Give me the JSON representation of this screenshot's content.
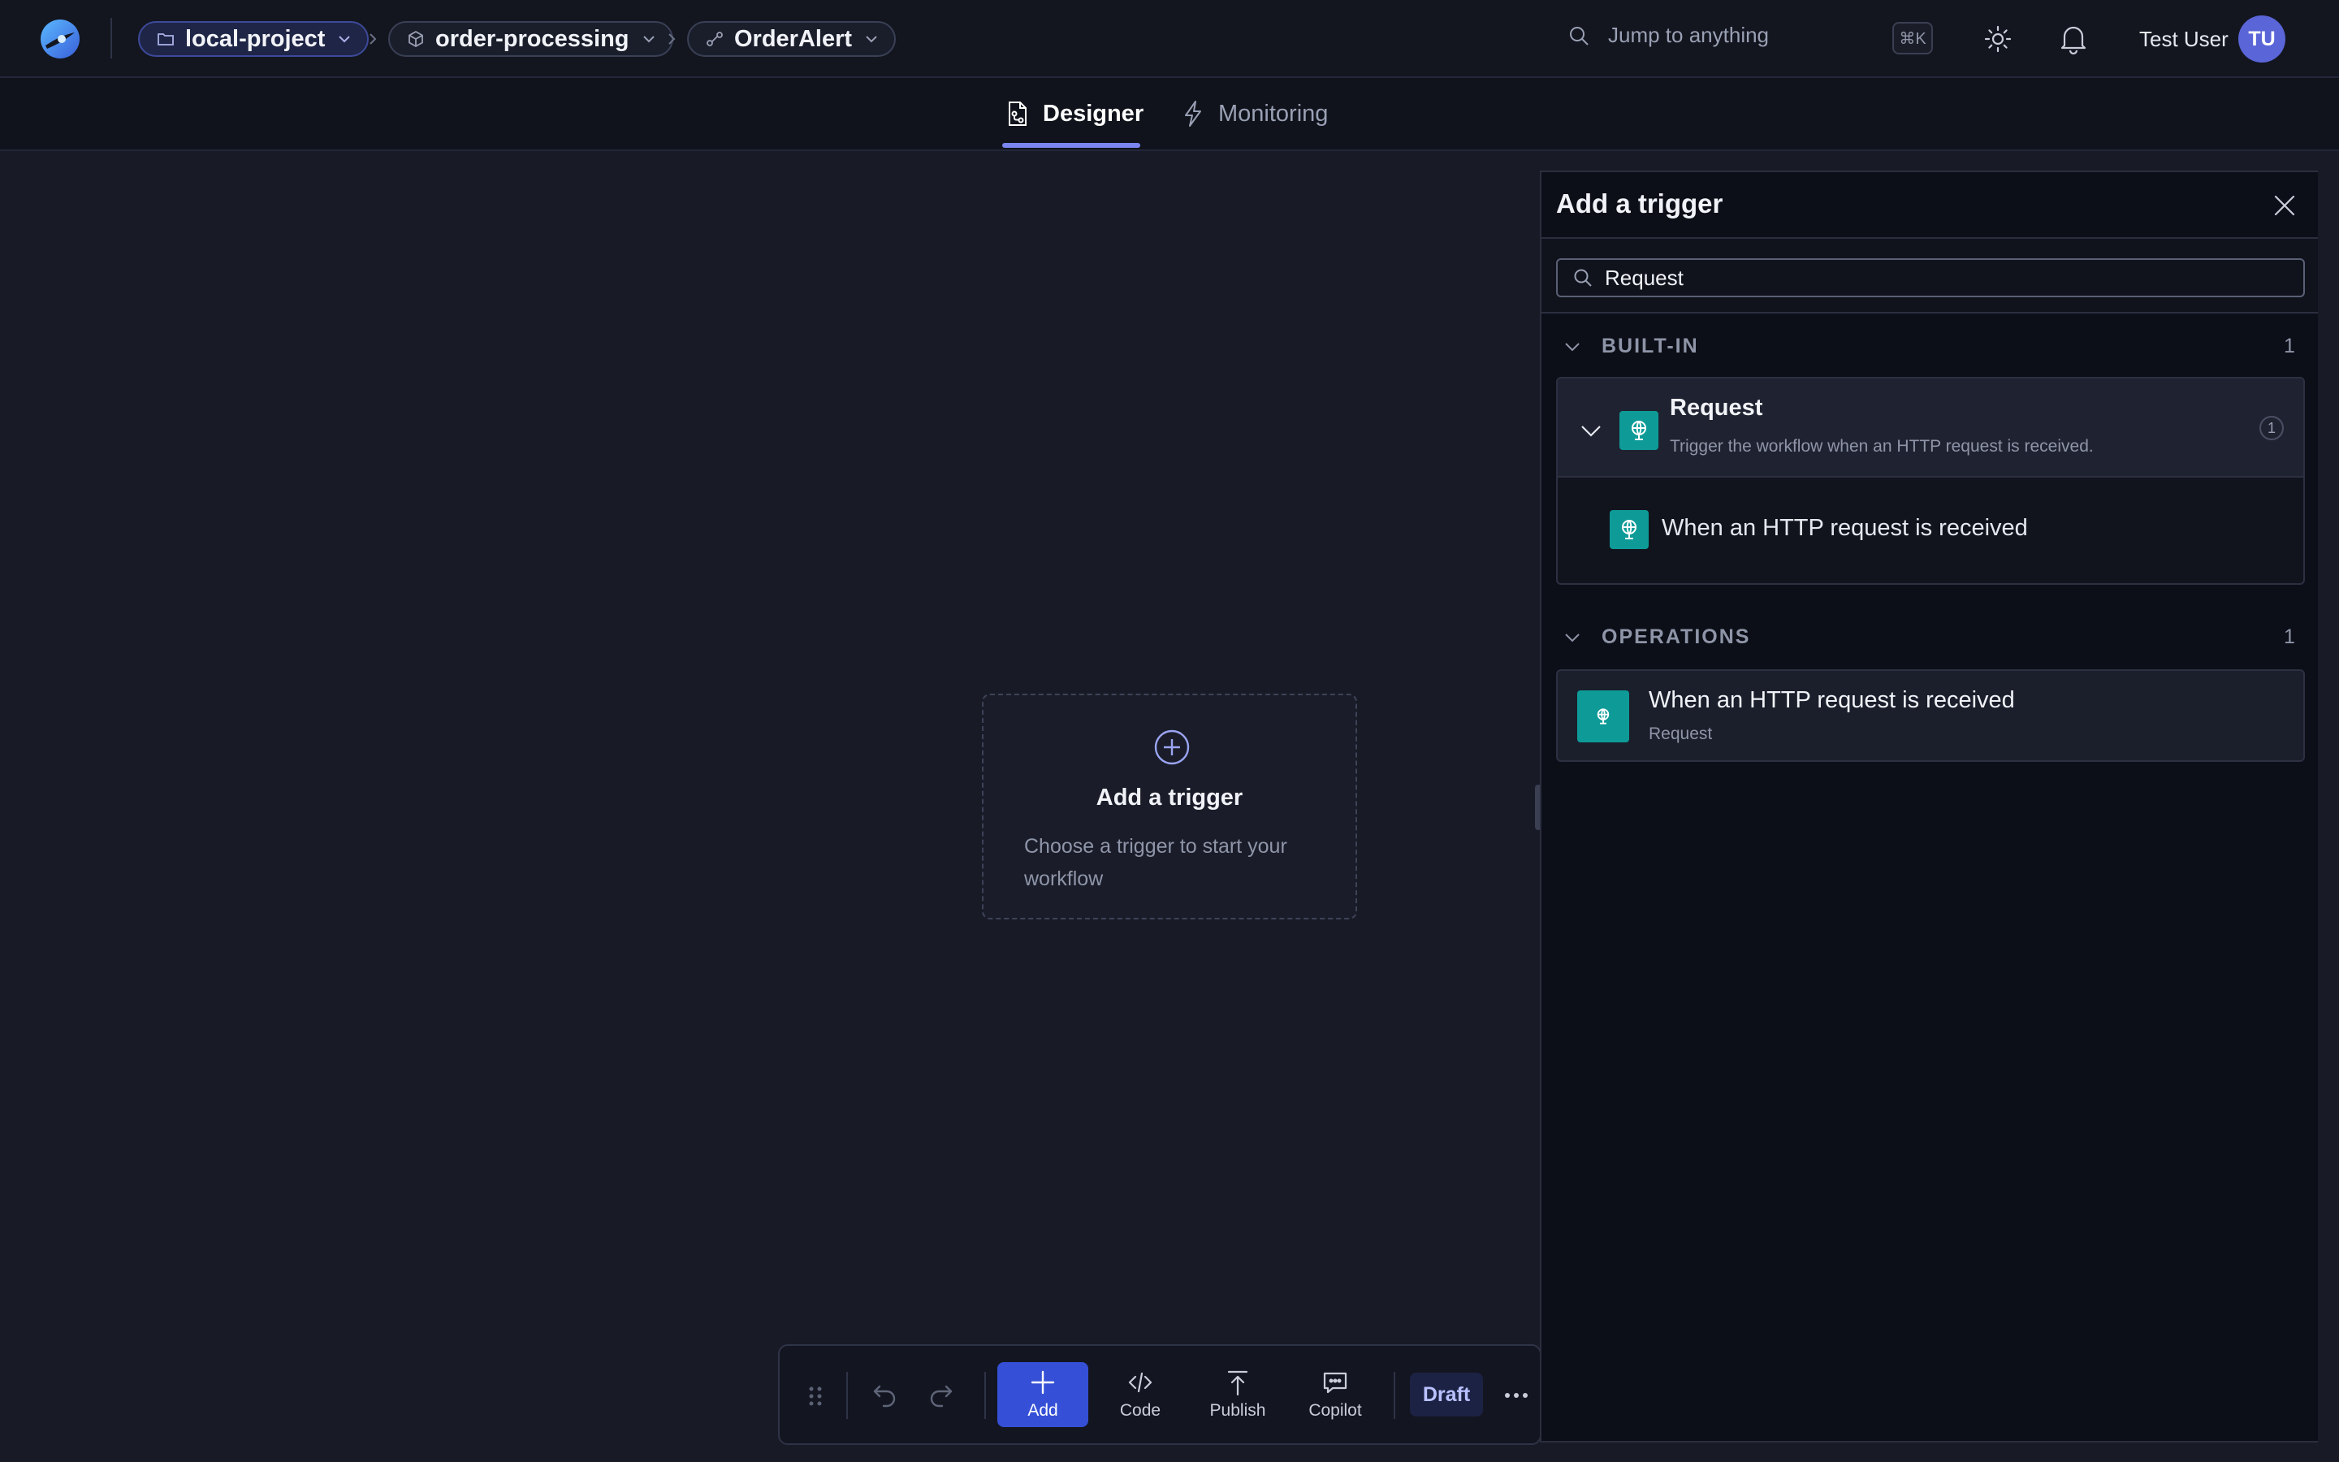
{
  "header": {
    "breadcrumbs": [
      {
        "label": "local-project",
        "icon": "folder-icon"
      },
      {
        "label": "order-processing",
        "icon": "cube-icon"
      },
      {
        "label": "OrderAlert",
        "icon": "workflow-icon"
      }
    ],
    "search_placeholder": "Jump to anything",
    "shortcut": "⌘K",
    "user_name": "Test User",
    "user_initials": "TU"
  },
  "tabs": [
    {
      "label": "Designer",
      "icon": "designer-icon",
      "active": true
    },
    {
      "label": "Monitoring",
      "icon": "bolt-icon",
      "active": false
    }
  ],
  "canvas": {
    "card_title": "Add a trigger",
    "card_description": "Choose a trigger to start your workflow"
  },
  "toolbar": {
    "add_label": "Add",
    "code_label": "Code",
    "publish_label": "Publish",
    "copilot_label": "Copilot",
    "status": "Draft"
  },
  "panel": {
    "title": "Add a trigger",
    "search_value": "Request",
    "sections": [
      {
        "label": "BUILT-IN",
        "count": "1",
        "group": {
          "title": "Request",
          "description": "Trigger the workflow when an HTTP request is received.",
          "count": "1",
          "items": [
            {
              "label": "When an HTTP request is received"
            }
          ]
        }
      },
      {
        "label": "OPERATIONS",
        "count": "1",
        "items": [
          {
            "title": "When an HTTP request is received",
            "subtitle": "Request"
          }
        ]
      }
    ]
  },
  "colors": {
    "accent": "#7b85f0",
    "primary_button": "#3550d6",
    "connector": "#0e9b98",
    "avatar": "#5a65d8"
  }
}
